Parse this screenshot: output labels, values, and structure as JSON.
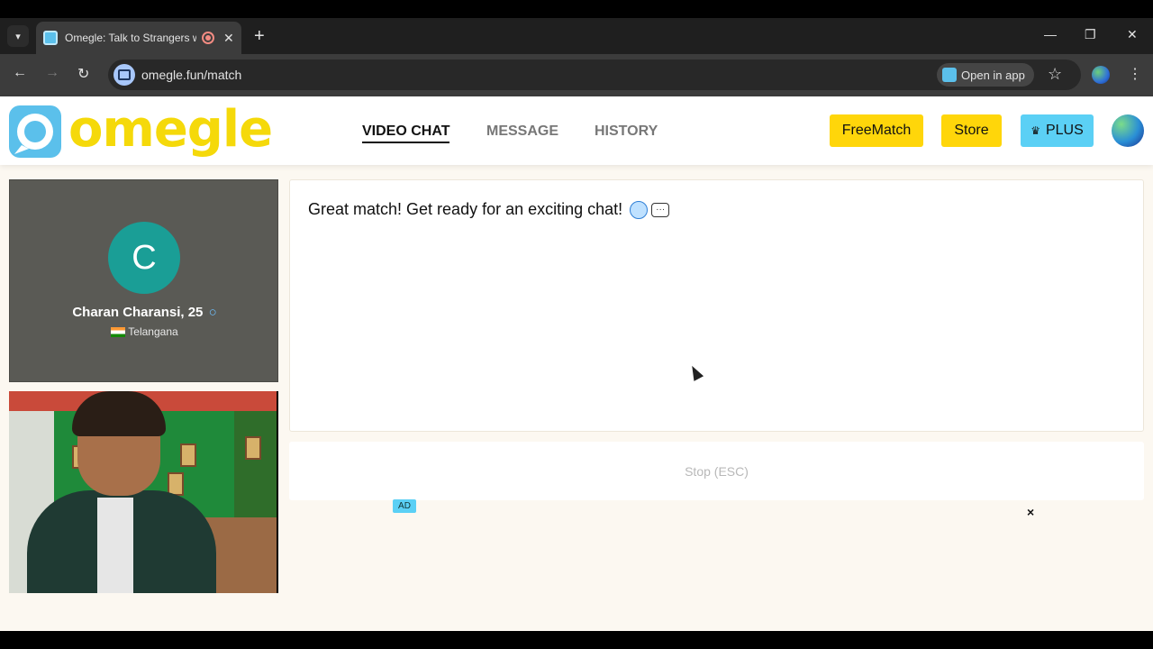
{
  "browser": {
    "tab_title": "Omegle: Talk to Strangers w",
    "tab_close": "✕",
    "new_tab": "+",
    "url": "omegle.fun/match",
    "open_in_app": "Open in app",
    "window_controls": {
      "minimize": "—",
      "restore": "❐",
      "close": "✕"
    }
  },
  "header": {
    "logo_text": "omegle",
    "nav": [
      {
        "label": "VIDEO CHAT",
        "active": true
      },
      {
        "label": "MESSAGE",
        "active": false
      },
      {
        "label": "HISTORY",
        "active": false
      }
    ],
    "buttons": {
      "freematch": "FreeMatch",
      "store": "Store",
      "plus": "PLUS"
    }
  },
  "profile": {
    "initial": "C",
    "name": "Charan Charansi, 25",
    "location": "Telangana",
    "avatar_color": "#1a9e96"
  },
  "chat": {
    "message": "Great match! Get ready for an exciting chat!",
    "stop_label": "Stop (ESC)"
  },
  "ad": {
    "tag": "AD",
    "close": "×"
  },
  "colors": {
    "brand_yellow": "#ffd60a",
    "plus_blue": "#5bd0f5"
  }
}
